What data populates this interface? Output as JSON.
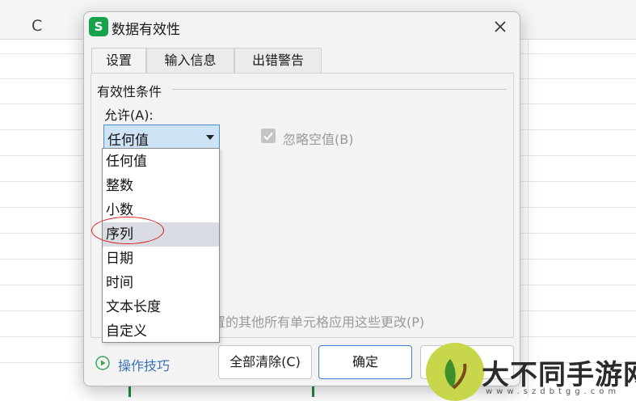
{
  "spreadsheet": {
    "column_letter": "C"
  },
  "dialog": {
    "app_icon_letter": "S",
    "title": "数据有效性",
    "tabs": [
      {
        "label": "设置",
        "active": true
      },
      {
        "label": "输入信息",
        "active": false
      },
      {
        "label": "出错警告",
        "active": false
      }
    ],
    "group_title": "有效性条件",
    "allow_label": "允许(A):",
    "allow_value": "任何值",
    "ignore_blank_label": "忽略空值(B)",
    "apply_all_label": "置的其他所有单元格应用这些更改(P)",
    "tips_label": "操作技巧",
    "buttons": {
      "clear": "全部清除(C)",
      "ok": "确定"
    }
  },
  "dropdown": {
    "options": [
      "任何值",
      "整数",
      "小数",
      "序列",
      "日期",
      "时间",
      "文本长度",
      "自定义"
    ],
    "highlighted": "序列"
  },
  "watermark": {
    "text": "大不同手游网",
    "url": "www.szdbtgg.com"
  },
  "colors": {
    "accent": "#16a34a",
    "select_bg": "#cfe3f7",
    "annotation": "#d92020"
  }
}
